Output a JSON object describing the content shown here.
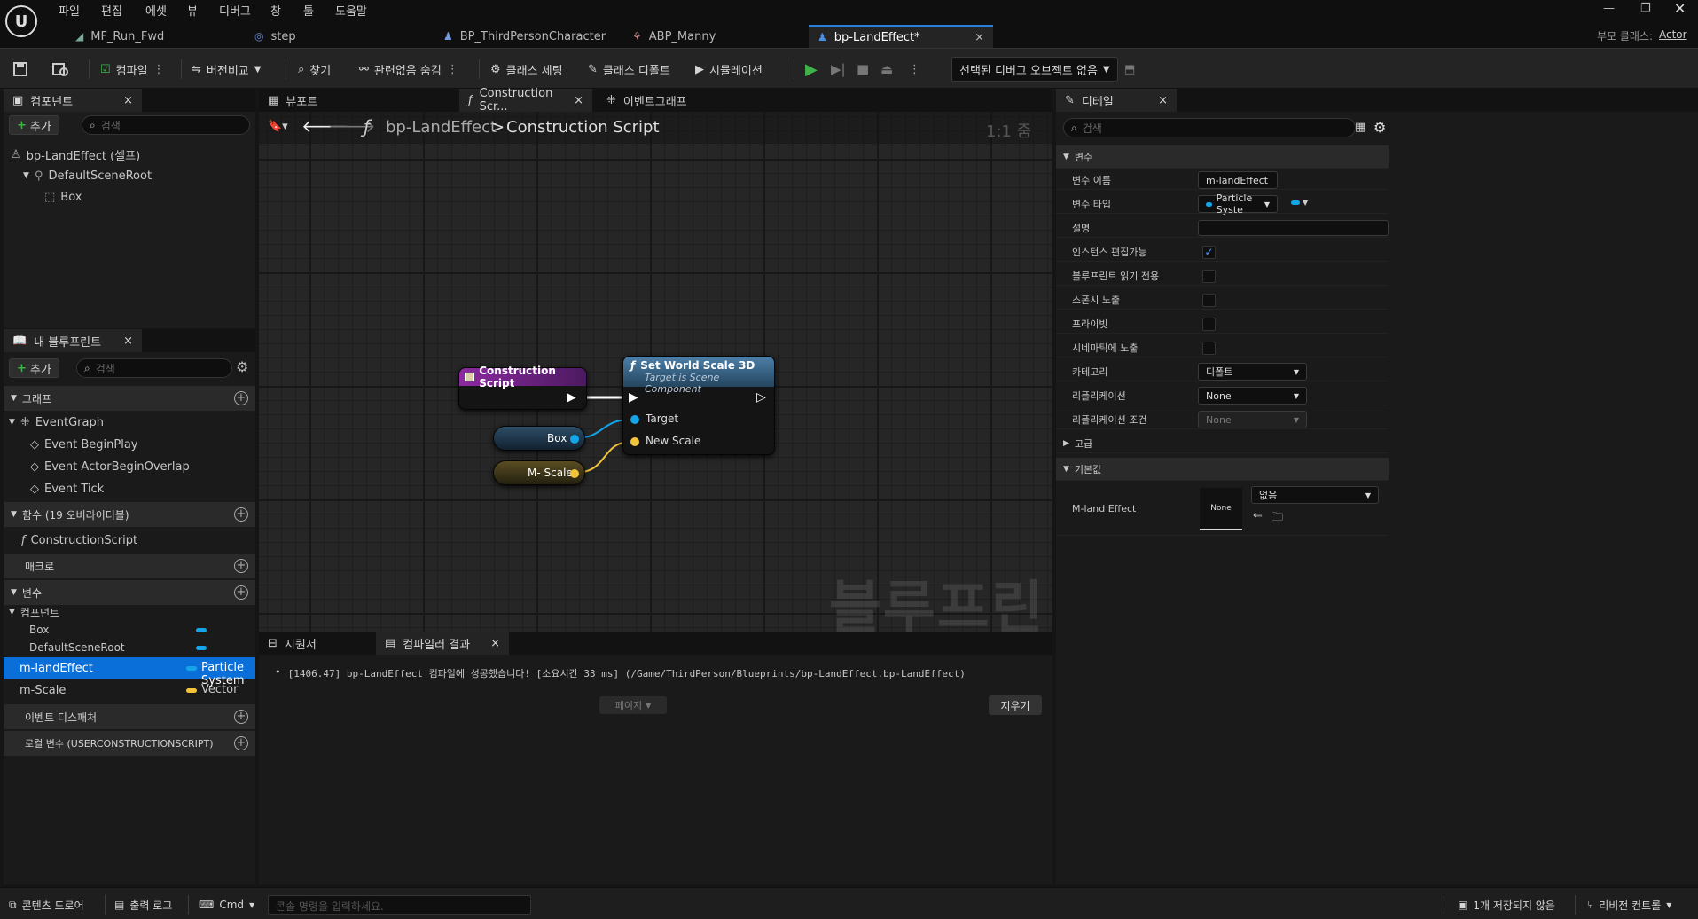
{
  "menu": [
    "파일",
    "편집",
    "에셋",
    "뷰",
    "디버그",
    "창",
    "툴",
    "도움말"
  ],
  "doc_tabs": [
    "MF_Run_Fwd",
    "step",
    "BP_ThirdPersonCharacter",
    "ABP_Manny",
    "bp-LandEffect*"
  ],
  "parent_class": {
    "label": "부모 클래스:",
    "value": "Actor"
  },
  "toolbar": {
    "compile": "컴파일",
    "diff": "버전비교",
    "find": "찾기",
    "hide_unrelated": "관련없음 숨김",
    "class_settings": "클래스 세팅",
    "class_defaults": "클래스 디폴트",
    "simulation": "시뮬레이션",
    "debug_object": "선택된 디버그 오브젝트 없음"
  },
  "components": {
    "tab": "컴포넌트",
    "add": "추가",
    "search_placeholder": "검색",
    "items": [
      "bp-LandEffect (셀프)",
      "DefaultSceneRoot",
      "Box"
    ]
  },
  "my_blueprint": {
    "tab": "내 블루프린트",
    "add": "추가",
    "search_placeholder": "검색",
    "graph_section": "그래프",
    "event_graph": "EventGraph",
    "events": [
      "Event BeginPlay",
      "Event ActorBeginOverlap",
      "Event Tick"
    ],
    "functions_section": "함수 (19 오버라이더블)",
    "construction_script": "ConstructionScript",
    "macros_section": "매크로",
    "variables_section": "변수",
    "components_category": "컴포넌트",
    "component_vars": [
      "Box",
      "DefaultSceneRoot"
    ],
    "vars": [
      {
        "name": "m-landEffect",
        "type": "Particle System"
      },
      {
        "name": "m-Scale",
        "type": "Vector"
      }
    ],
    "dispatchers_section": "이벤트 디스패처",
    "local_vars_section": "로컬 변수 (USERCONSTRUCTIONSCRIPT)"
  },
  "graph_tabs": [
    "뷰포트",
    "Construction Scr...",
    "이벤트그래프"
  ],
  "breadcrumb": {
    "root": "bp-LandEffect",
    "sep": ">",
    "current": "Construction Script",
    "zoom": "1:1 줌"
  },
  "watermark": "블루프린트",
  "nodes": {
    "construction": "Construction Script",
    "set_scale": "Set World Scale 3D",
    "set_scale_sub": "Target is Scene Component",
    "target": "Target",
    "new_scale": "New Scale",
    "box": "Box",
    "mscale": "M- Scale"
  },
  "bottom_tabs": {
    "sequencer": "시퀀서",
    "compiler": "컴파일러 결과"
  },
  "log": "[1406.47] bp-LandEffect 컴파일에 성공했습니다! [소요시간 33 ms] (/Game/ThirdPerson/Blueprints/bp-LandEffect.bp-LandEffect)",
  "page_label": "페이지",
  "clear_button": "지우기",
  "details": {
    "tab": "디테일",
    "search_placeholder": "검색",
    "var_section": "변수",
    "rows": [
      "변수 이름",
      "변수 타입",
      "설명",
      "인스턴스 편집가능",
      "블루프린트 읽기 전용",
      "스폰시 노출",
      "프라이빗",
      "시네마틱에 노출",
      "카테고리",
      "리플리케이션",
      "리플리케이션 조건"
    ],
    "var_name": "m-landEffect",
    "var_type": "Particle Syste",
    "category": "디폴트",
    "replication": "None",
    "replication_condition": "None",
    "advanced": "고급",
    "default_section": "기본값",
    "default_label": "M-land Effect",
    "thumb": "None",
    "asset": "없음"
  },
  "status": {
    "content_drawer": "콘텐츠 드로어",
    "output_log": "출력 로그",
    "cmd": "Cmd",
    "console_placeholder": "콘솔 명령을 입력하세요.",
    "unsaved": "1개 저장되지 않음",
    "revision": "리비전 컨트롤"
  },
  "colors": {
    "accent": "#2d7ed6",
    "object_pin": "#14a4e8",
    "vector_pin": "#f2c43a",
    "purple": "#7a1f8c"
  }
}
